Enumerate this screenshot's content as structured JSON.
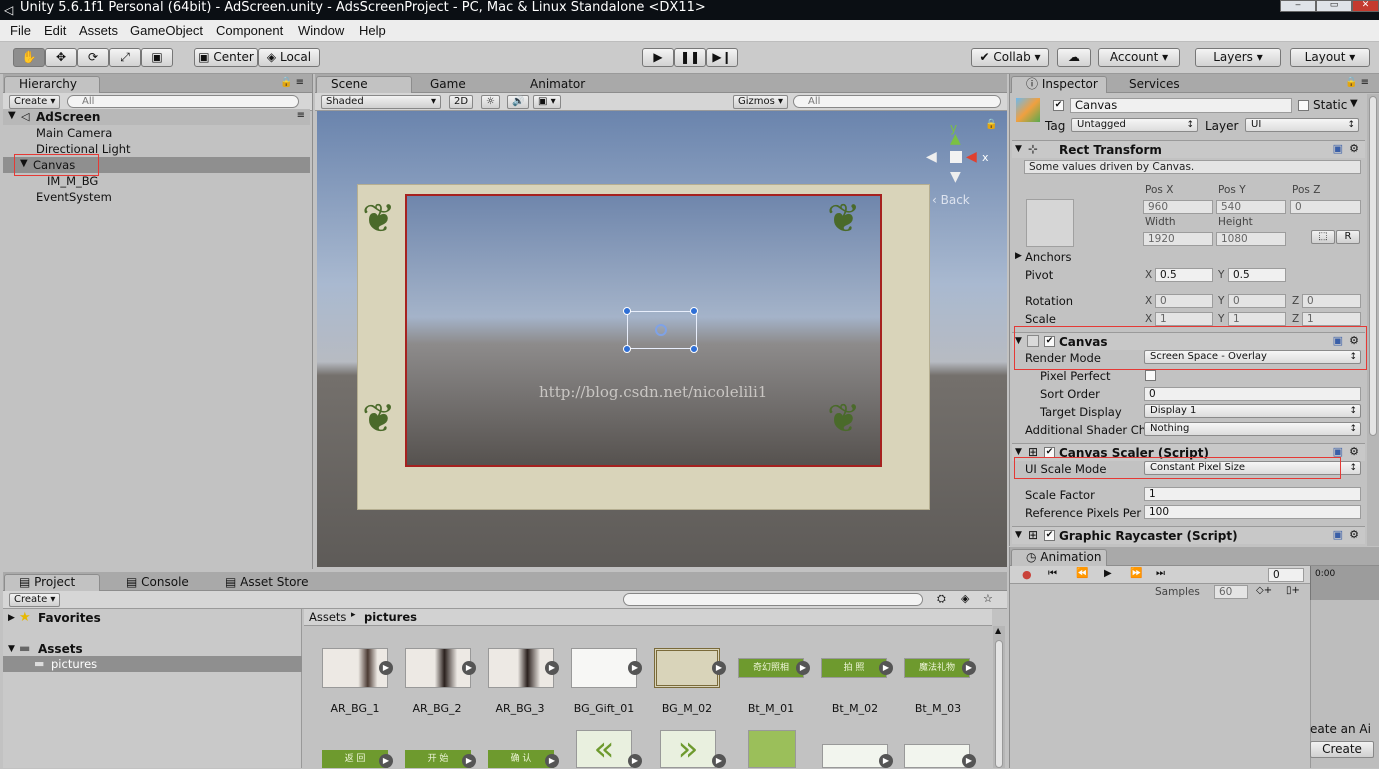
{
  "window": {
    "title": "Unity 5.6.1f1 Personal (64bit) - AdScreen.unity - AdsScreenProject - PC, Mac & Linux Standalone <DX11>"
  },
  "menu": [
    "File",
    "Edit",
    "Assets",
    "GameObject",
    "Component",
    "Window",
    "Help"
  ],
  "toolbar": {
    "center": "Center",
    "local": "Local",
    "collab": "Collab",
    "account": "Account",
    "layers": "Layers",
    "layout": "Layout"
  },
  "hierarchy": {
    "tab": "Hierarchy",
    "create": "Create",
    "search": "All",
    "scene": "AdScreen",
    "items": [
      "Main Camera",
      "Directional Light",
      "Canvas",
      "IM_M_BG",
      "EventSystem"
    ]
  },
  "scene": {
    "tabs": [
      "Scene",
      "Game",
      "Animator"
    ],
    "shading": "Shaded",
    "mode2d": "2D",
    "gizmos": "Gizmos",
    "search": "All",
    "back": "Back",
    "watermark": "http://blog.csdn.net/nicolelili1",
    "axis_x": "x",
    "axis_y": "y"
  },
  "inspector": {
    "tabs": [
      "Inspector",
      "Services"
    ],
    "object_name": "Canvas",
    "static_label": "Static",
    "tag_label": "Tag",
    "tag_value": "Untagged",
    "layer_label": "Layer",
    "layer_value": "UI",
    "rect": {
      "title": "Rect Transform",
      "note": "Some values driven by Canvas.",
      "posx_l": "Pos X",
      "posy_l": "Pos Y",
      "posz_l": "Pos Z",
      "posx": "960",
      "posy": "540",
      "posz": "0",
      "width_l": "Width",
      "height_l": "Height",
      "width": "1920",
      "height": "1080",
      "r": "R",
      "anchors": "Anchors",
      "pivot": "Pivot",
      "pivot_x": "0.5",
      "pivot_y": "0.5",
      "rotation": "Rotation",
      "rot_x": "0",
      "rot_y": "0",
      "rot_z": "0",
      "scale": "Scale",
      "sc_x": "1",
      "sc_y": "1",
      "sc_z": "1",
      "x": "X",
      "y": "Y",
      "z": "Z"
    },
    "canvas": {
      "title": "Canvas",
      "render_mode_l": "Render Mode",
      "render_mode": "Screen Space - Overlay",
      "pixel_perfect": "Pixel Perfect",
      "sort_order_l": "Sort Order",
      "sort_order": "0",
      "target_display_l": "Target Display",
      "target_display": "Display 1",
      "shader_l": "Additional Shader Ch",
      "shader": "Nothing"
    },
    "scaler": {
      "title": "Canvas Scaler (Script)",
      "mode_l": "UI Scale Mode",
      "mode": "Constant Pixel Size",
      "factor_l": "Scale Factor",
      "factor": "1",
      "ref_l": "Reference Pixels Per",
      "ref": "100"
    },
    "raycaster": {
      "title": "Graphic Raycaster (Script)"
    }
  },
  "animation": {
    "tab": "Animation",
    "frame": "0",
    "samples_l": "Samples",
    "samples": "60",
    "time": "0:00",
    "create_hint": "eate an Ai",
    "create": "Create"
  },
  "project": {
    "tabs": [
      "Project",
      "Console",
      "Asset Store"
    ],
    "create": "Create",
    "favorites": "Favorites",
    "assets": "Assets",
    "pictures": "pictures",
    "breadcrumb_root": "Assets",
    "breadcrumb_leaf": "pictures",
    "items": [
      "AR_BG_1",
      "AR_BG_2",
      "AR_BG_3",
      "BG_Gift_01",
      "BG_M_02",
      "Bt_M_01",
      "Bt_M_02",
      "Bt_M_03"
    ],
    "btn_texts": [
      "奇幻照相",
      "拍 照",
      "魔法礼物",
      "返 回",
      "开 始",
      "确 认"
    ]
  }
}
